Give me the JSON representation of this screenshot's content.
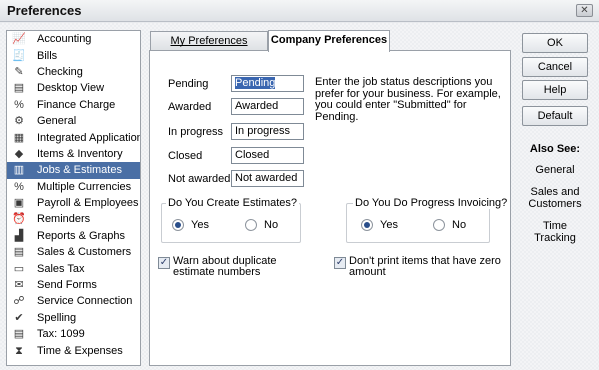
{
  "window": {
    "title": "Preferences",
    "close_glyph": "✕"
  },
  "sidebar": {
    "selected_index": 8,
    "items": [
      {
        "label": "Accounting",
        "icon": "accounting-icon",
        "glyph": "📈"
      },
      {
        "label": "Bills",
        "icon": "bills-icon",
        "glyph": "🧾"
      },
      {
        "label": "Checking",
        "icon": "checking-icon",
        "glyph": "✎"
      },
      {
        "label": "Desktop View",
        "icon": "desktop-view-icon",
        "glyph": "▤"
      },
      {
        "label": "Finance Charge",
        "icon": "finance-charge-icon",
        "glyph": "%"
      },
      {
        "label": "General",
        "icon": "general-icon",
        "glyph": "⚙"
      },
      {
        "label": "Integrated Applications",
        "icon": "integrated-applications-icon",
        "glyph": "▦"
      },
      {
        "label": "Items & Inventory",
        "icon": "items-inventory-icon",
        "glyph": "◆"
      },
      {
        "label": "Jobs & Estimates",
        "icon": "jobs-estimates-icon",
        "glyph": "▥"
      },
      {
        "label": "Multiple Currencies",
        "icon": "multiple-currencies-icon",
        "glyph": "%"
      },
      {
        "label": "Payroll & Employees",
        "icon": "payroll-employees-icon",
        "glyph": "▣"
      },
      {
        "label": "Reminders",
        "icon": "reminders-icon",
        "glyph": "⏰"
      },
      {
        "label": "Reports & Graphs",
        "icon": "reports-graphs-icon",
        "glyph": "▟"
      },
      {
        "label": "Sales & Customers",
        "icon": "sales-customers-icon",
        "glyph": "▤"
      },
      {
        "label": "Sales Tax",
        "icon": "sales-tax-icon",
        "glyph": "▭"
      },
      {
        "label": "Send Forms",
        "icon": "send-forms-icon",
        "glyph": "✉"
      },
      {
        "label": "Service Connection",
        "icon": "service-connection-icon",
        "glyph": "☍"
      },
      {
        "label": "Spelling",
        "icon": "spelling-icon",
        "glyph": "✔"
      },
      {
        "label": "Tax: 1099",
        "icon": "tax-1099-icon",
        "glyph": "▤"
      },
      {
        "label": "Time & Expenses",
        "icon": "time-expenses-icon",
        "glyph": "⧗"
      }
    ]
  },
  "tabs": {
    "my_preferences": "My Preferences",
    "company_preferences": "Company Preferences",
    "active": "company_preferences"
  },
  "job_status": {
    "fields": [
      {
        "key": "pending",
        "label": "Pending",
        "value": "Pending",
        "selected": true
      },
      {
        "key": "awarded",
        "label": "Awarded",
        "value": "Awarded"
      },
      {
        "key": "in_progress",
        "label": "In progress",
        "value": "In progress"
      },
      {
        "key": "closed",
        "label": "Closed",
        "value": "Closed"
      },
      {
        "key": "not_awarded",
        "label": "Not awarded",
        "value": "Not awarded"
      }
    ],
    "help_text": "Enter the job status descriptions you prefer for your business.  For example, you could enter \"Submitted\" for Pending."
  },
  "estimates": {
    "title": "Do You Create Estimates?",
    "yes_label": "Yes",
    "no_label": "No",
    "selected": "yes"
  },
  "progress_invoicing": {
    "title": "Do You Do Progress Invoicing?",
    "yes_label": "Yes",
    "no_label": "No",
    "selected": "yes"
  },
  "checkboxes": {
    "warn_duplicate": {
      "label": "Warn about duplicate estimate numbers",
      "checked": true
    },
    "dont_print_zero": {
      "label": "Don't print items that have zero amount",
      "checked": true
    }
  },
  "buttons": {
    "ok": "OK",
    "cancel": "Cancel",
    "help": "Help",
    "default": "Default"
  },
  "also_see": {
    "title": "Also See:",
    "links": [
      "General",
      "Sales and Customers",
      "Time Tracking"
    ]
  }
}
